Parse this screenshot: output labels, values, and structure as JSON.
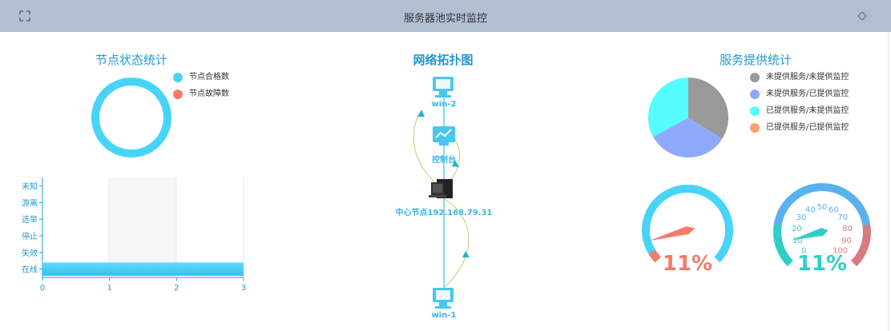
{
  "header": {
    "title": "服务器池实时监控",
    "expand_icon": "expand-icon",
    "menu_icon": "diamond-menu-icon"
  },
  "node_status": {
    "title": "节点状态统计",
    "legend": [
      {
        "label": "节点合格数",
        "color": "#48d4f8"
      },
      {
        "label": "节点故障数",
        "color": "#f47b6a"
      }
    ],
    "donut": {
      "healthy": 1,
      "faulty": 0
    }
  },
  "chart_data": [
    {
      "type": "bar",
      "orientation": "horizontal",
      "categories": [
        "在线",
        "失效",
        "停止",
        "选举",
        "游离",
        "未知"
      ],
      "values": [
        3,
        0,
        0,
        0,
        0,
        0
      ],
      "xlim": [
        0,
        3
      ],
      "xticks": [
        "0",
        "1",
        "2",
        "3"
      ]
    },
    {
      "type": "pie",
      "slices": [
        {
          "label": "未提供服务/未提供监控",
          "value": 34,
          "color": "#999999"
        },
        {
          "label": "未提供服务/已提供监控",
          "value": 33,
          "color": "#8ea9fb"
        },
        {
          "label": "已提供服务/未提供监控",
          "value": 33,
          "color": "#56fdfd"
        },
        {
          "label": "已提供服务/已提供监控",
          "value": 0,
          "color": "#ffa36b"
        }
      ]
    }
  ],
  "topology": {
    "title": "网络拓扑图",
    "nodes": [
      {
        "label": "win-2",
        "icon": "monitor-icon"
      },
      {
        "label": "控制台",
        "icon": "dashboard-icon"
      },
      {
        "label": "中心节点192.168.79.31",
        "icon": "server-icon"
      },
      {
        "label": "win-1",
        "icon": "monitor-icon"
      }
    ]
  },
  "service": {
    "title": "服务提供统计"
  },
  "gauges": [
    {
      "value": 11,
      "display": "11%",
      "color": "#48d4f8",
      "pointer_color": "#f47b6a",
      "text_color": "#f47b6a"
    },
    {
      "value": 11,
      "display": "11%",
      "ticks": [
        "0",
        "10",
        "20",
        "30",
        "40",
        "50",
        "60",
        "70",
        "80",
        "90",
        "100"
      ],
      "pointer_color": "#2dcfc5",
      "text_color": "#2dcfc5",
      "band_colors": [
        "#2dcfc5",
        "#5ab1ef",
        "#d87a80"
      ]
    }
  ]
}
